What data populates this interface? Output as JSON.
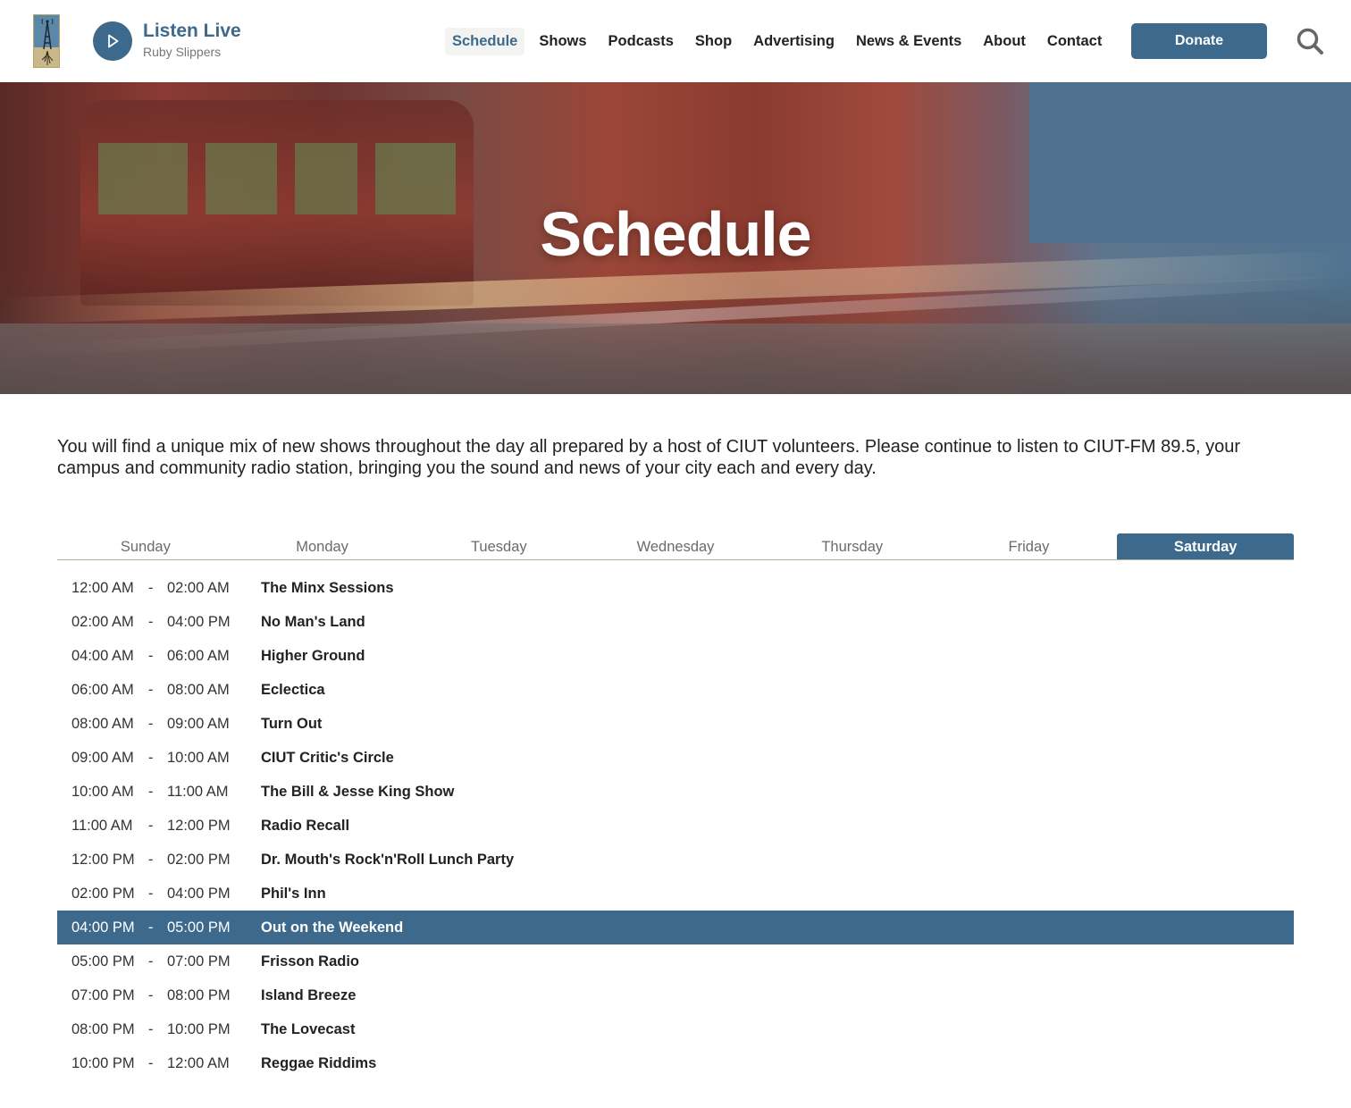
{
  "header": {
    "logo_icon": "radio-tower-logo",
    "player": {
      "play_icon": "play-icon",
      "title": "Listen Live",
      "subtitle": "Ruby Slippers"
    },
    "nav": [
      {
        "label": "Schedule",
        "active": true
      },
      {
        "label": "Shows"
      },
      {
        "label": "Podcasts"
      },
      {
        "label": "Shop"
      },
      {
        "label": "Advertising"
      },
      {
        "label": "News & Events"
      },
      {
        "label": "About"
      },
      {
        "label": "Contact"
      }
    ],
    "donate_label": "Donate",
    "search_icon": "search-icon"
  },
  "hero": {
    "title": "Schedule"
  },
  "intro": "You will find a unique mix of new shows throughout the day all prepared by a host of CIUT volunteers. Please continue to listen to CIUT-FM 89.5, your campus and community radio station, bringing you the sound and news of your city each and every day.",
  "days": [
    {
      "label": "Sunday"
    },
    {
      "label": "Monday"
    },
    {
      "label": "Tuesday"
    },
    {
      "label": "Wednesday"
    },
    {
      "label": "Thursday"
    },
    {
      "label": "Friday"
    },
    {
      "label": "Saturday",
      "active": true
    }
  ],
  "schedule": [
    {
      "start": "12:00 AM",
      "end": "02:00 AM",
      "show": "The Minx Sessions"
    },
    {
      "start": "02:00 AM",
      "end": "04:00 PM",
      "show": "No Man's Land"
    },
    {
      "start": "04:00 AM",
      "end": "06:00 AM",
      "show": "Higher Ground"
    },
    {
      "start": "06:00 AM",
      "end": "08:00 AM",
      "show": "Eclectica"
    },
    {
      "start": "08:00 AM",
      "end": "09:00 AM",
      "show": "Turn Out"
    },
    {
      "start": "09:00 AM",
      "end": "10:00 AM",
      "show": "CIUT Critic's Circle"
    },
    {
      "start": "10:00 AM",
      "end": "11:00 AM",
      "show": "The Bill & Jesse King Show"
    },
    {
      "start": "11:00 AM",
      "end": "12:00 PM",
      "show": "Radio Recall"
    },
    {
      "start": "12:00 PM",
      "end": "02:00 PM",
      "show": "Dr. Mouth's Rock'n'Roll Lunch Party"
    },
    {
      "start": "02:00 PM",
      "end": "04:00 PM",
      "show": "Phil's Inn"
    },
    {
      "start": "04:00 PM",
      "end": "05:00 PM",
      "show": "Out on the Weekend",
      "current": true
    },
    {
      "start": "05:00 PM",
      "end": "07:00 PM",
      "show": "Frisson Radio"
    },
    {
      "start": "07:00 PM",
      "end": "08:00 PM",
      "show": "Island Breeze"
    },
    {
      "start": "08:00 PM",
      "end": "10:00 PM",
      "show": "The Lovecast"
    },
    {
      "start": "10:00 PM",
      "end": "12:00 AM",
      "show": "Reggae Riddims"
    }
  ],
  "time_separator": "-",
  "colors": {
    "accent": "#3d6a8c",
    "text": "#222222",
    "muted": "#6b6b6b"
  }
}
